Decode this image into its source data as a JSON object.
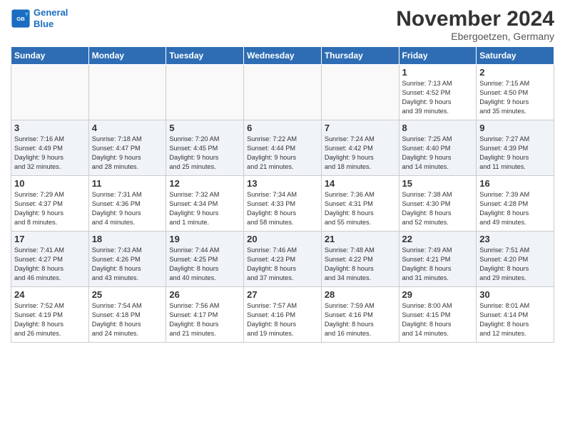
{
  "logo": {
    "line1": "General",
    "line2": "Blue"
  },
  "title": "November 2024",
  "subtitle": "Ebergoetzen, Germany",
  "weekdays": [
    "Sunday",
    "Monday",
    "Tuesday",
    "Wednesday",
    "Thursday",
    "Friday",
    "Saturday"
  ],
  "weeks": [
    [
      {
        "day": "",
        "info": ""
      },
      {
        "day": "",
        "info": ""
      },
      {
        "day": "",
        "info": ""
      },
      {
        "day": "",
        "info": ""
      },
      {
        "day": "",
        "info": ""
      },
      {
        "day": "1",
        "info": "Sunrise: 7:13 AM\nSunset: 4:52 PM\nDaylight: 9 hours\nand 39 minutes."
      },
      {
        "day": "2",
        "info": "Sunrise: 7:15 AM\nSunset: 4:50 PM\nDaylight: 9 hours\nand 35 minutes."
      }
    ],
    [
      {
        "day": "3",
        "info": "Sunrise: 7:16 AM\nSunset: 4:49 PM\nDaylight: 9 hours\nand 32 minutes."
      },
      {
        "day": "4",
        "info": "Sunrise: 7:18 AM\nSunset: 4:47 PM\nDaylight: 9 hours\nand 28 minutes."
      },
      {
        "day": "5",
        "info": "Sunrise: 7:20 AM\nSunset: 4:45 PM\nDaylight: 9 hours\nand 25 minutes."
      },
      {
        "day": "6",
        "info": "Sunrise: 7:22 AM\nSunset: 4:44 PM\nDaylight: 9 hours\nand 21 minutes."
      },
      {
        "day": "7",
        "info": "Sunrise: 7:24 AM\nSunset: 4:42 PM\nDaylight: 9 hours\nand 18 minutes."
      },
      {
        "day": "8",
        "info": "Sunrise: 7:25 AM\nSunset: 4:40 PM\nDaylight: 9 hours\nand 14 minutes."
      },
      {
        "day": "9",
        "info": "Sunrise: 7:27 AM\nSunset: 4:39 PM\nDaylight: 9 hours\nand 11 minutes."
      }
    ],
    [
      {
        "day": "10",
        "info": "Sunrise: 7:29 AM\nSunset: 4:37 PM\nDaylight: 9 hours\nand 8 minutes."
      },
      {
        "day": "11",
        "info": "Sunrise: 7:31 AM\nSunset: 4:36 PM\nDaylight: 9 hours\nand 4 minutes."
      },
      {
        "day": "12",
        "info": "Sunrise: 7:32 AM\nSunset: 4:34 PM\nDaylight: 9 hours\nand 1 minute."
      },
      {
        "day": "13",
        "info": "Sunrise: 7:34 AM\nSunset: 4:33 PM\nDaylight: 8 hours\nand 58 minutes."
      },
      {
        "day": "14",
        "info": "Sunrise: 7:36 AM\nSunset: 4:31 PM\nDaylight: 8 hours\nand 55 minutes."
      },
      {
        "day": "15",
        "info": "Sunrise: 7:38 AM\nSunset: 4:30 PM\nDaylight: 8 hours\nand 52 minutes."
      },
      {
        "day": "16",
        "info": "Sunrise: 7:39 AM\nSunset: 4:28 PM\nDaylight: 8 hours\nand 49 minutes."
      }
    ],
    [
      {
        "day": "17",
        "info": "Sunrise: 7:41 AM\nSunset: 4:27 PM\nDaylight: 8 hours\nand 46 minutes."
      },
      {
        "day": "18",
        "info": "Sunrise: 7:43 AM\nSunset: 4:26 PM\nDaylight: 8 hours\nand 43 minutes."
      },
      {
        "day": "19",
        "info": "Sunrise: 7:44 AM\nSunset: 4:25 PM\nDaylight: 8 hours\nand 40 minutes."
      },
      {
        "day": "20",
        "info": "Sunrise: 7:46 AM\nSunset: 4:23 PM\nDaylight: 8 hours\nand 37 minutes."
      },
      {
        "day": "21",
        "info": "Sunrise: 7:48 AM\nSunset: 4:22 PM\nDaylight: 8 hours\nand 34 minutes."
      },
      {
        "day": "22",
        "info": "Sunrise: 7:49 AM\nSunset: 4:21 PM\nDaylight: 8 hours\nand 31 minutes."
      },
      {
        "day": "23",
        "info": "Sunrise: 7:51 AM\nSunset: 4:20 PM\nDaylight: 8 hours\nand 29 minutes."
      }
    ],
    [
      {
        "day": "24",
        "info": "Sunrise: 7:52 AM\nSunset: 4:19 PM\nDaylight: 8 hours\nand 26 minutes."
      },
      {
        "day": "25",
        "info": "Sunrise: 7:54 AM\nSunset: 4:18 PM\nDaylight: 8 hours\nand 24 minutes."
      },
      {
        "day": "26",
        "info": "Sunrise: 7:56 AM\nSunset: 4:17 PM\nDaylight: 8 hours\nand 21 minutes."
      },
      {
        "day": "27",
        "info": "Sunrise: 7:57 AM\nSunset: 4:16 PM\nDaylight: 8 hours\nand 19 minutes."
      },
      {
        "day": "28",
        "info": "Sunrise: 7:59 AM\nSunset: 4:16 PM\nDaylight: 8 hours\nand 16 minutes."
      },
      {
        "day": "29",
        "info": "Sunrise: 8:00 AM\nSunset: 4:15 PM\nDaylight: 8 hours\nand 14 minutes."
      },
      {
        "day": "30",
        "info": "Sunrise: 8:01 AM\nSunset: 4:14 PM\nDaylight: 8 hours\nand 12 minutes."
      }
    ]
  ]
}
